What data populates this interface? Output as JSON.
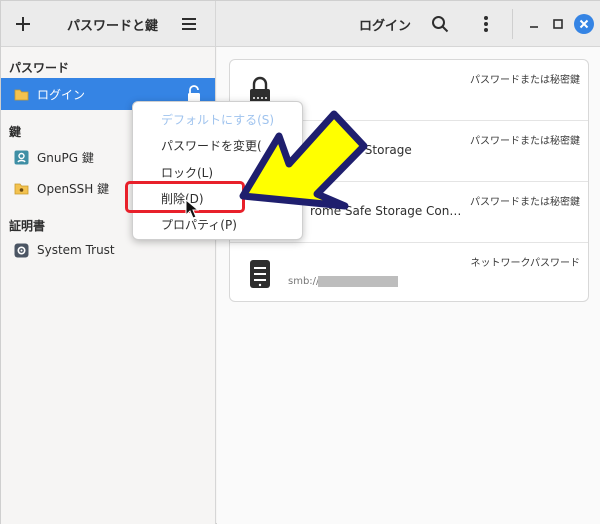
{
  "header": {
    "add_icon": "plus-icon",
    "title": "パスワードと鍵",
    "menu_icon": "hamburger-icon",
    "location_title": "ログイン",
    "search_icon": "search-icon",
    "more_icon": "vertical-dots-icon",
    "minimize_icon": "minimize-icon",
    "maximize_icon": "maximize-icon",
    "close_icon": "close-icon"
  },
  "sidebar": {
    "sections": [
      {
        "label": "パスワード",
        "items": [
          {
            "label": "ログイン",
            "icon": "folder-icon",
            "selected": true,
            "badge_icon": "unlocked-padlock-icon"
          }
        ]
      },
      {
        "label": "鍵",
        "items": [
          {
            "label": "GnuPG 鍵",
            "icon": "gnupg-key-icon"
          },
          {
            "label": "OpenSSH 鍵",
            "icon": "folder-key-icon"
          }
        ]
      },
      {
        "label": "証明書",
        "items": [
          {
            "label": "System Trust",
            "icon": "gear-icon"
          }
        ]
      }
    ]
  },
  "main": {
    "items": [
      {
        "name": "",
        "type": "パスワードまたは秘密鍵",
        "icon": "padlock-icon"
      },
      {
        "name": "afe Storage",
        "type": "パスワードまたは秘密鍵"
      },
      {
        "name": "rome Safe Storage Con…",
        "type": "パスワードまたは秘密鍵"
      },
      {
        "name": "",
        "sub": "smb://            nas.local/",
        "type": "ネットワークパスワード",
        "icon": "server-icon"
      }
    ]
  },
  "context_menu": {
    "items": [
      {
        "label": "デフォルトにする(S)",
        "disabled": true
      },
      {
        "label": "パスワードを変更(",
        "disabled": false
      },
      {
        "label": "ロック(L)",
        "disabled": false
      },
      {
        "label": "削除(D)",
        "disabled": false,
        "highlighted": true
      },
      {
        "label": "プロパティ(P)",
        "disabled": false
      }
    ]
  },
  "colors": {
    "accent": "#3584e4",
    "highlight_box": "#e8202a",
    "annotation_arrow": "#ffff00",
    "annotation_outline": "#1f1f6e"
  }
}
